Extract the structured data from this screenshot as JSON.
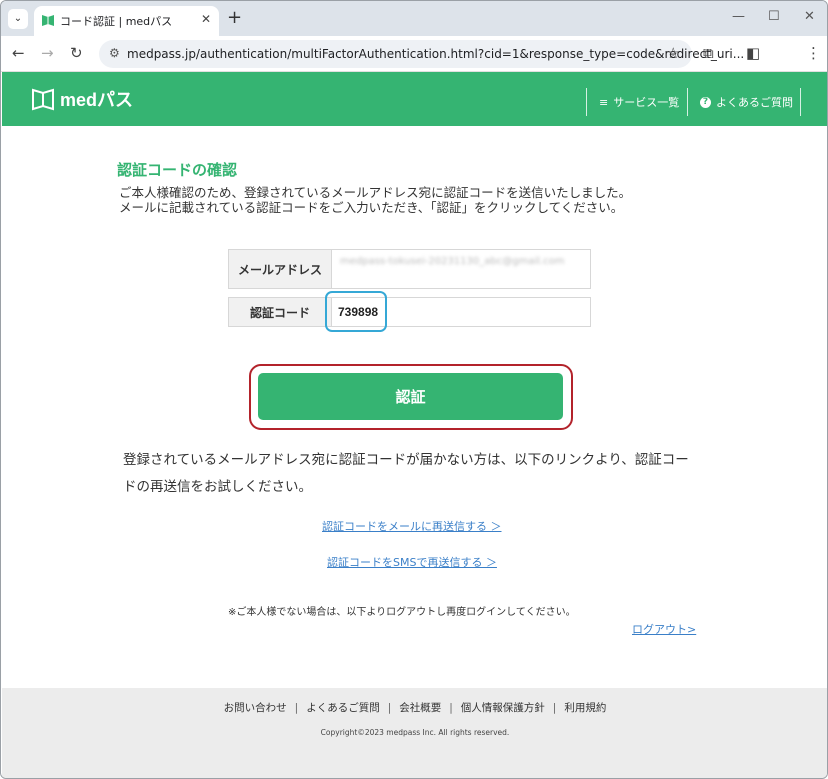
{
  "browser": {
    "tab_title": "コード認証 | medパス",
    "url": "medpass.jp/authentication/multiFactorAuthentication.html?cid=1&response_type=code&redirect_uri..."
  },
  "header": {
    "logo_text": "medパス",
    "services_label": "サービス一覧",
    "faq_label": "よくあるご質問"
  },
  "main": {
    "title": "認証コードの確認",
    "intro_line1": "ご本人様確認のため、登録されているメールアドレス宛に認証コードを送信いたしました。",
    "intro_line2": "メールに記載されている認証コードをご入力いただき、「認証」をクリックしてください。",
    "email_label": "メールアドレス",
    "email_value": "medpass-tokusei-20231130_abc@gmail.com",
    "code_label": "認証コード",
    "code_value": "739898",
    "submit_label": "認証",
    "notice": "登録されているメールアドレス宛に認証コードが届かない方は、以下のリンクより、認証コードの再送信をお試しください。",
    "resend_email": "認証コードをメールに再送信する ＞",
    "resend_sms": "認証コードをSMSで再送信する ＞",
    "note": "※ご本人様でない場合は、以下よりログアウトし再度ログインしてください。",
    "logout": "ログアウト>"
  },
  "footer": {
    "links": [
      "お問い合わせ",
      "よくあるご質問",
      "会社概要",
      "個人情報保護方針",
      "利用規約"
    ],
    "copyright": "Copyright©2023 medpass Inc. All rights reserved."
  },
  "colors": {
    "brand_green": "#35b472",
    "link_blue": "#3a7fc8",
    "highlight_red": "#b3232b",
    "highlight_blue": "#35a8d6"
  }
}
